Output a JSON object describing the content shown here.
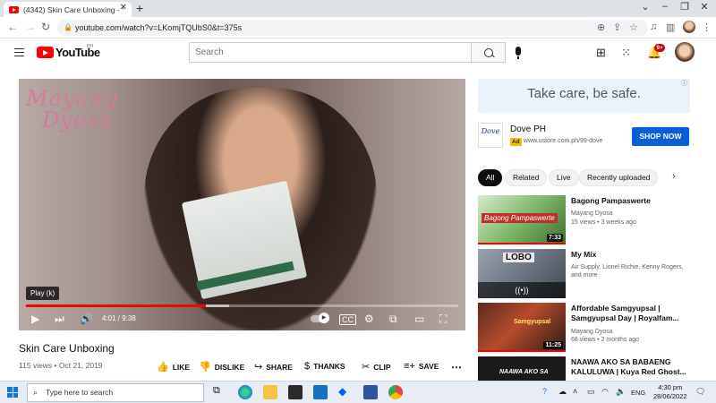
{
  "browser": {
    "tab_title": "(4342) Skin Care Unboxing - You",
    "url": "youtube.com/watch?v=LKomjTQUbS0&t=375s",
    "new_tab_icon": "plus-icon"
  },
  "header": {
    "logo_text": "YouTube",
    "country": "PH",
    "search_placeholder": "Search",
    "notification_count": "9+"
  },
  "player": {
    "watermark_line1": "Mayang",
    "watermark_line2": "Dyosa",
    "tooltip": "Play (k)",
    "time": "4:01 / 9:38",
    "progress_played": 0.417,
    "progress_buffered": 0.47
  },
  "video": {
    "title": "Skin Care Unboxing",
    "meta": "115 views • Oct 21, 2019",
    "actions": {
      "like": "LIKE",
      "dislike": "DISLIKE",
      "share": "SHARE",
      "thanks": "THANKS",
      "clip": "CLIP",
      "save": "SAVE"
    }
  },
  "ad": {
    "banner_text": "Take care, be safe.",
    "logo_text": "Dove",
    "advertiser": "Dove PH",
    "badge": "Ad",
    "url": "www.ustore.com.ph/99-dove",
    "cta": "SHOP NOW"
  },
  "chips": [
    "All",
    "Related",
    "Live",
    "Recently uploaded"
  ],
  "recommendations": [
    {
      "title": "Bagong Pampaswerte",
      "channel": "Mayang Dyosa",
      "meta": "15 views • 3 weeks ago",
      "duration": "7:33",
      "thumb_text": "Bagong Pampaswerte",
      "watched": true
    },
    {
      "title": "My Mix",
      "channel": "Air Supply, Lionel Richie, Kenny Rogers, and more",
      "meta": "",
      "duration": "",
      "thumb_text": "LOBO",
      "watched": false
    },
    {
      "title": "Affordable Samgyupsal | Samgyupsal Day | Royalfam...",
      "channel": "Mayang Dyosa",
      "meta": "68 views • 2 months ago",
      "duration": "11:25",
      "thumb_text": "Samgyupsal",
      "watched": true
    },
    {
      "title": "NAAWA AKO SA BABAENG KALULUWA | Kuya Red Ghost...",
      "channel": "",
      "meta": "",
      "duration": "",
      "thumb_text": "NAAWA AKO SA",
      "watched": false
    }
  ],
  "taskbar": {
    "search_placeholder": "Type here to search",
    "language": "ENG",
    "time": "4:30 pm",
    "date": "28/06/2022"
  }
}
